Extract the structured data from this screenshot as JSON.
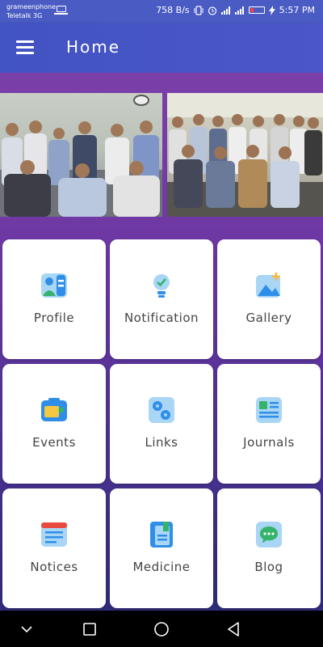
{
  "status_bar": {
    "carrier_1": "grameenphone",
    "carrier_2": "Teletalk 3G",
    "speed": "758 B/s",
    "time": "5:57 PM"
  },
  "app_bar": {
    "title": "Home"
  },
  "menu": [
    {
      "label": "Profile",
      "icon": "profile-icon"
    },
    {
      "label": "Notification",
      "icon": "lightbulb-icon"
    },
    {
      "label": "Gallery",
      "icon": "gallery-icon"
    },
    {
      "label": "Events",
      "icon": "camera-icon"
    },
    {
      "label": "Links",
      "icon": "gears-icon"
    },
    {
      "label": "Journals",
      "icon": "journal-icon"
    },
    {
      "label": "Notices",
      "icon": "notice-icon"
    },
    {
      "label": "Medicine",
      "icon": "medicine-book-icon"
    },
    {
      "label": "Blog",
      "icon": "chat-icon"
    }
  ],
  "colors": {
    "app_bar": "#4254c2",
    "status_bar": "#4a5cc4",
    "gradient_top": "#7b3fa8",
    "gradient_bottom": "#2f2c7a",
    "icon_blue": "#2f8fe8",
    "icon_light_blue": "#a9d6f5"
  }
}
